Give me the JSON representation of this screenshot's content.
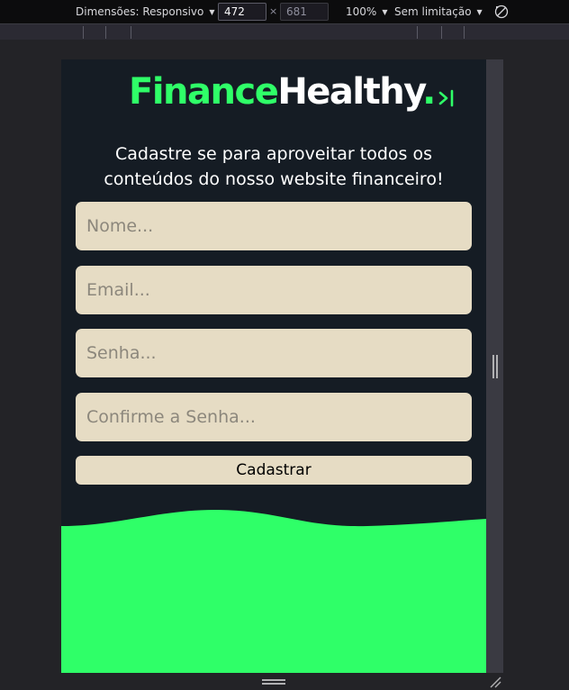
{
  "devtools": {
    "dimensions_label": "Dimensões: Responsivo",
    "width_value": "472",
    "height_value": "681",
    "times_sign": "×",
    "zoom_label": "100%",
    "throttle_label": "Sem limitação",
    "caret": "▼"
  },
  "page": {
    "logo_part1": "Finance",
    "logo_part2": "Healthy",
    "logo_dot": ".",
    "menu_toggle_glyph": ">|",
    "subtitle": "Cadastre se para aproveitar todos os conteúdos do nosso website financeiro!",
    "fields": {
      "name_placeholder": "Nome...",
      "email_placeholder": "Email...",
      "password_placeholder": "Senha...",
      "confirm_placeholder": "Confirme a Senha..."
    },
    "submit_label": "Cadastrar"
  },
  "colors": {
    "accent_green": "#2fff68",
    "background_dark": "#151c24",
    "input_beige": "#e6dcc4"
  },
  "icons": [
    "rotate-icon",
    "menu-toggle-icon",
    "resize-handle-icon"
  ]
}
